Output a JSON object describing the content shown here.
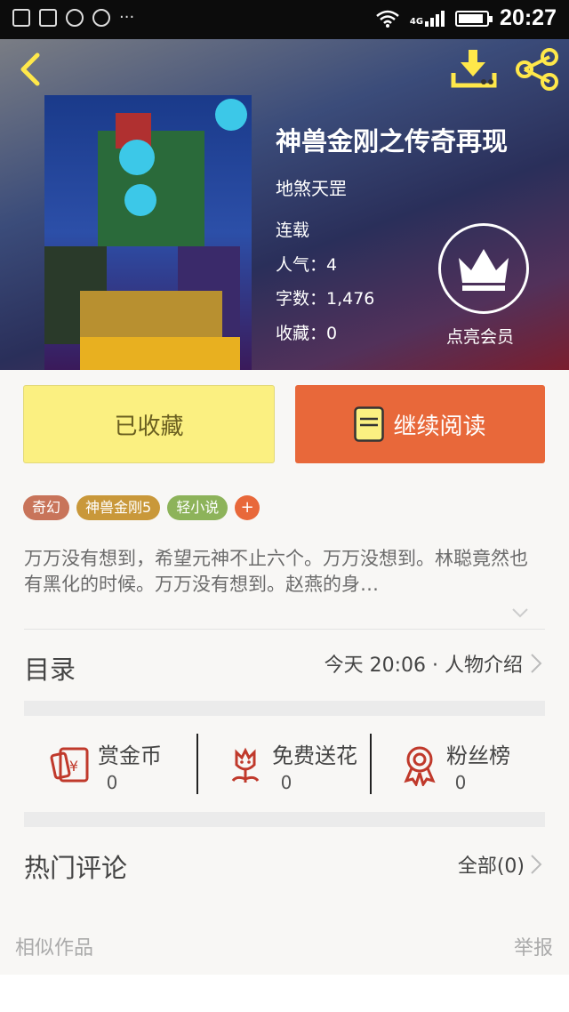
{
  "status_bar": {
    "time": "20:27",
    "network": "4G",
    "battery_fraction": 0.9
  },
  "book": {
    "title": "神兽金刚之传奇再现",
    "author": "地煞天罡",
    "status": "连载",
    "popularity": "人气：4",
    "word_count": "字数：1,476",
    "favorites": "收藏：0"
  },
  "vip": {
    "label": "点亮会员"
  },
  "actions": {
    "favorited_label": "已收藏",
    "continue_label": "继续阅读"
  },
  "tags": [
    {
      "label": "奇幻",
      "color": "#c8745a"
    },
    {
      "label": "神兽金刚5",
      "color": "#c9983a"
    },
    {
      "label": "轻小说",
      "color": "#8db35a"
    },
    {
      "label": "+",
      "color": "#e8683a"
    }
  ],
  "description": "万万没有想到，希望元神不止六个。万万没想到。林聪竟然也有黑化的时候。万万没有想到。赵燕的身…",
  "toc": {
    "title": "目录",
    "latest": "今天 20:06 · 人物介绍"
  },
  "stats": [
    {
      "label": "赏金币",
      "value": "0",
      "icon": "red-envelope-icon"
    },
    {
      "label": "免费送花",
      "value": "0",
      "icon": "flower-icon"
    },
    {
      "label": "粉丝榜",
      "value": "0",
      "icon": "medal-icon"
    }
  ],
  "comments": {
    "title": "热门评论",
    "all_label": "全部(0)"
  },
  "footer": {
    "similar_label": "相似作品",
    "report_label": "举报"
  },
  "colors": {
    "accent_orange": "#e8683a",
    "accent_yellow": "#fbf081",
    "icon_red": "#c0392b",
    "header_icon_yellow": "#ffe84a"
  }
}
